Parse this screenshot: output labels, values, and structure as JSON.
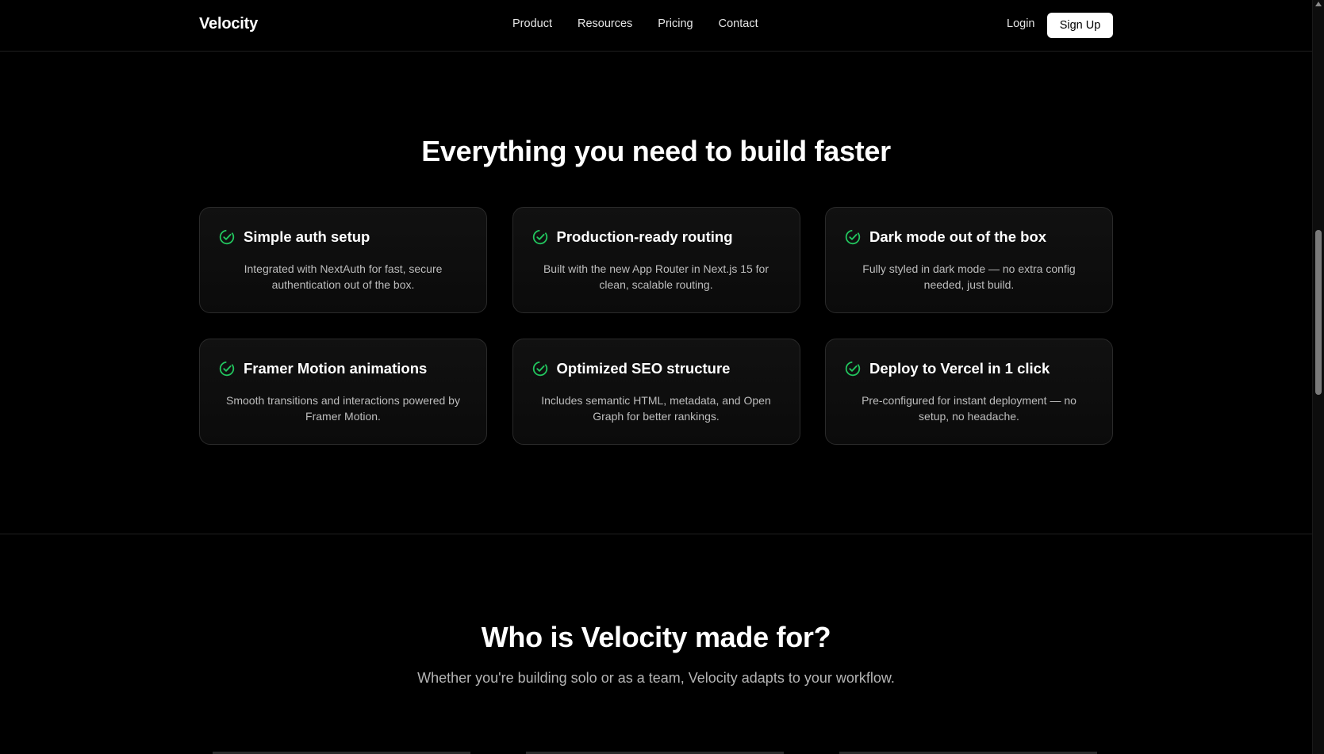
{
  "header": {
    "logo": "Velocity",
    "nav": [
      "Product",
      "Resources",
      "Pricing",
      "Contact"
    ],
    "login_label": "Login",
    "signup_label": "Sign Up"
  },
  "features": {
    "title": "Everything you need to build faster",
    "icon": "check-circle-icon",
    "accent_color": "#22c55e",
    "cards": [
      {
        "title": "Simple auth setup",
        "description": "Integrated with NextAuth for fast, secure authentication out of the box."
      },
      {
        "title": "Production-ready routing",
        "description": "Built with the new App Router in Next.js 15 for clean, scalable routing."
      },
      {
        "title": "Dark mode out of the box",
        "description": "Fully styled in dark mode — no extra config needed, just build."
      },
      {
        "title": "Framer Motion animations",
        "description": "Smooth transitions and interactions powered by Framer Motion."
      },
      {
        "title": "Optimized SEO structure",
        "description": "Includes semantic HTML, metadata, and Open Graph for better rankings."
      },
      {
        "title": "Deploy to Vercel in 1 click",
        "description": "Pre-configured for instant deployment — no setup, no headache."
      }
    ]
  },
  "who": {
    "title": "Who is Velocity made for?",
    "subtitle": "Whether you're building solo or as a team, Velocity adapts to your workflow."
  },
  "colors": {
    "background": "#000000",
    "card_border": "#2a2a2a",
    "text_muted": "#bdbdbd"
  }
}
